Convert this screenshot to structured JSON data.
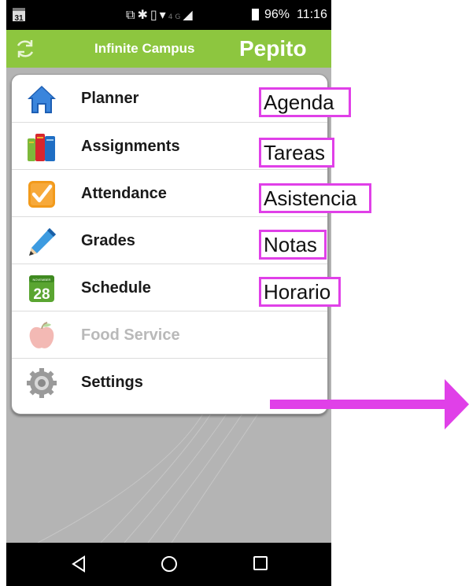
{
  "status_bar": {
    "calendar_day": "31",
    "network": "4G",
    "battery": "96%",
    "time": "11:16"
  },
  "app_bar": {
    "title": "Infinite Campus",
    "user": "Pepito"
  },
  "menu": {
    "items": [
      {
        "label": "Planner",
        "icon": "house-icon",
        "enabled": true
      },
      {
        "label": "Assignments",
        "icon": "books-icon",
        "enabled": true
      },
      {
        "label": "Attendance",
        "icon": "checkmark-icon",
        "enabled": true
      },
      {
        "label": "Grades",
        "icon": "pencil-icon",
        "enabled": true
      },
      {
        "label": "Schedule",
        "icon": "calendar-icon",
        "enabled": true,
        "calendar_month": "NOVEMBER",
        "calendar_day": "28"
      },
      {
        "label": "Food Service",
        "icon": "apple-icon",
        "enabled": false
      },
      {
        "label": "Settings",
        "icon": "gear-icon",
        "enabled": true
      }
    ]
  },
  "annotations": [
    "Agenda",
    "Tareas",
    "Asistencia",
    "Notas",
    "Horario"
  ],
  "colors": {
    "app_bar": "#8dc63f",
    "annotation": "#e040e8",
    "background": "#b4b4b4"
  }
}
